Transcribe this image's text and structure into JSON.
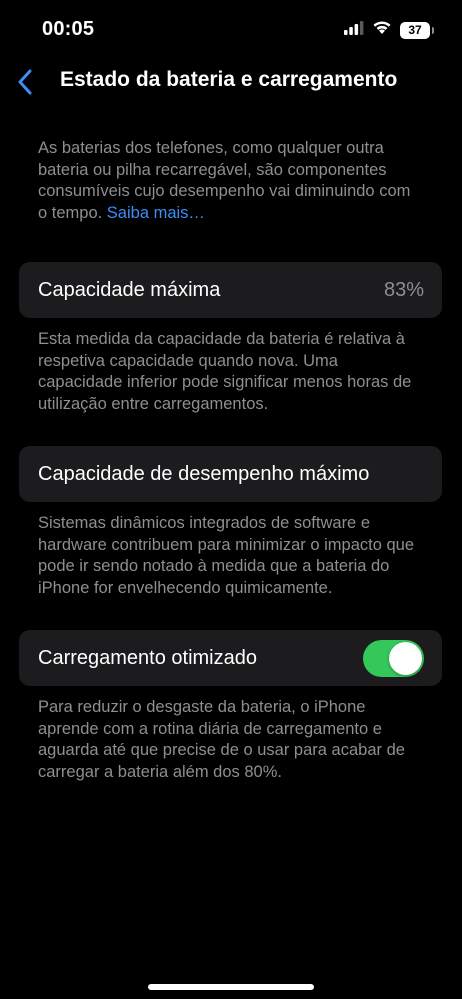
{
  "status_bar": {
    "time": "00:05",
    "battery_level": "37",
    "icons": [
      "cellular-signal-icon",
      "wifi-icon",
      "battery-icon"
    ]
  },
  "nav": {
    "back_icon": "chevron-left-icon",
    "title": "Estado da bateria e carregamento"
  },
  "intro": {
    "text": "As baterias dos telefones, como qualquer outra bateria ou pilha recarregável, são componentes consumíveis cujo desempenho vai diminuindo com o tempo. ",
    "link_label": "Saiba mais…"
  },
  "max_capacity": {
    "label": "Capacidade máxima",
    "value": "83%",
    "description": "Esta medida da capacidade da bateria é relativa à respetiva capacidade quando nova. Uma capacidade inferior pode significar menos horas de utilização entre carregamentos."
  },
  "peak_performance": {
    "label": "Capacidade de desempenho máximo",
    "description": "Sistemas dinâmicos integrados de software e hardware contribuem para minimizar o impacto que pode ir sendo notado à medida que a bateria do iPhone for envelhecendo quimicamente."
  },
  "optimized_charging": {
    "label": "Carregamento otimizado",
    "enabled": true,
    "description": "Para reduzir o desgaste da bateria, o iPhone aprende com a rotina diária de carregamento e aguarda até que precise de o usar para acabar de carregar a bateria além dos 80%."
  },
  "colors": {
    "background": "#000000",
    "cell_background": "#1c1c1e",
    "secondary_text": "#8e8e93",
    "accent_blue": "#3a8ef6",
    "toggle_on": "#34c759"
  }
}
